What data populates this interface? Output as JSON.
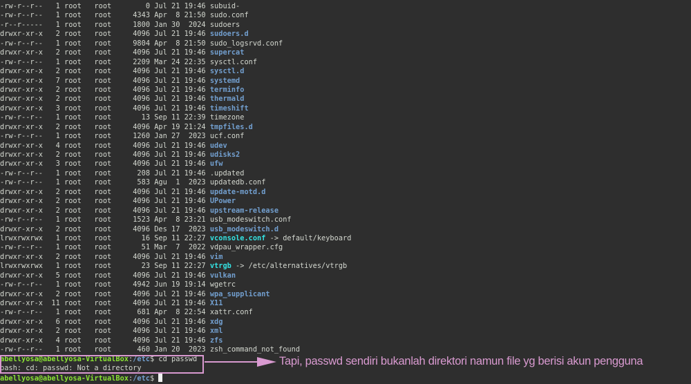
{
  "colors": {
    "background": "#2e2e2e",
    "text": "#d3d7cf",
    "directory": "#729fcf",
    "symlink": "#34e2e2",
    "prompt_user": "#8ae234",
    "annotation": "#d99ad0"
  },
  "listing": [
    {
      "perms": "-rw-r--r--",
      "links": "1",
      "owner": "root",
      "group": "root",
      "size": "0",
      "date": "Jul 21 19:46",
      "name": "subuid-",
      "type": "file"
    },
    {
      "perms": "-rw-r--r--",
      "links": "1",
      "owner": "root",
      "group": "root",
      "size": "4343",
      "date": "Apr  8 21:50",
      "name": "sudo.conf",
      "type": "file"
    },
    {
      "perms": "-r--r-----",
      "links": "1",
      "owner": "root",
      "group": "root",
      "size": "1800",
      "date": "Jan 30  2024",
      "name": "sudoers",
      "type": "file"
    },
    {
      "perms": "drwxr-xr-x",
      "links": "2",
      "owner": "root",
      "group": "root",
      "size": "4096",
      "date": "Jul 21 19:46",
      "name": "sudoers.d",
      "type": "dir"
    },
    {
      "perms": "-rw-r--r--",
      "links": "1",
      "owner": "root",
      "group": "root",
      "size": "9804",
      "date": "Apr  8 21:50",
      "name": "sudo_logsrvd.conf",
      "type": "file"
    },
    {
      "perms": "drwxr-xr-x",
      "links": "2",
      "owner": "root",
      "group": "root",
      "size": "4096",
      "date": "Jul 21 19:46",
      "name": "supercat",
      "type": "dir"
    },
    {
      "perms": "-rw-r--r--",
      "links": "1",
      "owner": "root",
      "group": "root",
      "size": "2209",
      "date": "Mar 24 22:35",
      "name": "sysctl.conf",
      "type": "file"
    },
    {
      "perms": "drwxr-xr-x",
      "links": "2",
      "owner": "root",
      "group": "root",
      "size": "4096",
      "date": "Jul 21 19:46",
      "name": "sysctl.d",
      "type": "dir"
    },
    {
      "perms": "drwxr-xr-x",
      "links": "7",
      "owner": "root",
      "group": "root",
      "size": "4096",
      "date": "Jul 21 19:46",
      "name": "systemd",
      "type": "dir"
    },
    {
      "perms": "drwxr-xr-x",
      "links": "2",
      "owner": "root",
      "group": "root",
      "size": "4096",
      "date": "Jul 21 19:46",
      "name": "terminfo",
      "type": "dir"
    },
    {
      "perms": "drwxr-xr-x",
      "links": "2",
      "owner": "root",
      "group": "root",
      "size": "4096",
      "date": "Jul 21 19:46",
      "name": "thermald",
      "type": "dir"
    },
    {
      "perms": "drwxr-xr-x",
      "links": "3",
      "owner": "root",
      "group": "root",
      "size": "4096",
      "date": "Jul 21 19:46",
      "name": "timeshift",
      "type": "dir"
    },
    {
      "perms": "-rw-r--r--",
      "links": "1",
      "owner": "root",
      "group": "root",
      "size": "13",
      "date": "Sep 11 22:39",
      "name": "timezone",
      "type": "file"
    },
    {
      "perms": "drwxr-xr-x",
      "links": "2",
      "owner": "root",
      "group": "root",
      "size": "4096",
      "date": "Apr 19 21:24",
      "name": "tmpfiles.d",
      "type": "dir"
    },
    {
      "perms": "-rw-r--r--",
      "links": "1",
      "owner": "root",
      "group": "root",
      "size": "1260",
      "date": "Jan 27  2023",
      "name": "ucf.conf",
      "type": "file"
    },
    {
      "perms": "drwxr-xr-x",
      "links": "4",
      "owner": "root",
      "group": "root",
      "size": "4096",
      "date": "Jul 21 19:46",
      "name": "udev",
      "type": "dir"
    },
    {
      "perms": "drwxr-xr-x",
      "links": "2",
      "owner": "root",
      "group": "root",
      "size": "4096",
      "date": "Jul 21 19:46",
      "name": "udisks2",
      "type": "dir"
    },
    {
      "perms": "drwxr-xr-x",
      "links": "3",
      "owner": "root",
      "group": "root",
      "size": "4096",
      "date": "Jul 21 19:46",
      "name": "ufw",
      "type": "dir"
    },
    {
      "perms": "-rw-r--r--",
      "links": "1",
      "owner": "root",
      "group": "root",
      "size": "208",
      "date": "Jul 21 19:46",
      "name": ".updated",
      "type": "file"
    },
    {
      "perms": "-rw-r--r--",
      "links": "1",
      "owner": "root",
      "group": "root",
      "size": "583",
      "date": "Agu  1  2023",
      "name": "updatedb.conf",
      "type": "file"
    },
    {
      "perms": "drwxr-xr-x",
      "links": "2",
      "owner": "root",
      "group": "root",
      "size": "4096",
      "date": "Jul 21 19:46",
      "name": "update-motd.d",
      "type": "dir"
    },
    {
      "perms": "drwxr-xr-x",
      "links": "2",
      "owner": "root",
      "group": "root",
      "size": "4096",
      "date": "Jul 21 19:46",
      "name": "UPower",
      "type": "dir"
    },
    {
      "perms": "drwxr-xr-x",
      "links": "2",
      "owner": "root",
      "group": "root",
      "size": "4096",
      "date": "Jul 21 19:46",
      "name": "upstream-release",
      "type": "dir"
    },
    {
      "perms": "-rw-r--r--",
      "links": "1",
      "owner": "root",
      "group": "root",
      "size": "1523",
      "date": "Apr  8 23:21",
      "name": "usb_modeswitch.conf",
      "type": "file"
    },
    {
      "perms": "drwxr-xr-x",
      "links": "2",
      "owner": "root",
      "group": "root",
      "size": "4096",
      "date": "Des 17  2023",
      "name": "usb_modeswitch.d",
      "type": "dir"
    },
    {
      "perms": "lrwxrwxrwx",
      "links": "1",
      "owner": "root",
      "group": "root",
      "size": "16",
      "date": "Sep 11 22:27",
      "name": "vconsole.conf",
      "type": "link",
      "target": " -> default/keyboard"
    },
    {
      "perms": "-rw-r--r--",
      "links": "1",
      "owner": "root",
      "group": "root",
      "size": "51",
      "date": "Mar  7  2022",
      "name": "vdpau_wrapper.cfg",
      "type": "file"
    },
    {
      "perms": "drwxr-xr-x",
      "links": "2",
      "owner": "root",
      "group": "root",
      "size": "4096",
      "date": "Jul 21 19:46",
      "name": "vim",
      "type": "dir"
    },
    {
      "perms": "lrwxrwxrwx",
      "links": "1",
      "owner": "root",
      "group": "root",
      "size": "23",
      "date": "Sep 11 22:27",
      "name": "vtrgb",
      "type": "link",
      "target": " -> /etc/alternatives/vtrgb"
    },
    {
      "perms": "drwxr-xr-x",
      "links": "5",
      "owner": "root",
      "group": "root",
      "size": "4096",
      "date": "Jul 21 19:46",
      "name": "vulkan",
      "type": "dir"
    },
    {
      "perms": "-rw-r--r--",
      "links": "1",
      "owner": "root",
      "group": "root",
      "size": "4942",
      "date": "Jun 19 19:14",
      "name": "wgetrc",
      "type": "file"
    },
    {
      "perms": "drwxr-xr-x",
      "links": "2",
      "owner": "root",
      "group": "root",
      "size": "4096",
      "date": "Jul 21 19:46",
      "name": "wpa_supplicant",
      "type": "dir"
    },
    {
      "perms": "drwxr-xr-x",
      "links": "11",
      "owner": "root",
      "group": "root",
      "size": "4096",
      "date": "Jul 21 19:46",
      "name": "X11",
      "type": "dir"
    },
    {
      "perms": "-rw-r--r--",
      "links": "1",
      "owner": "root",
      "group": "root",
      "size": "681",
      "date": "Apr  8 22:54",
      "name": "xattr.conf",
      "type": "file"
    },
    {
      "perms": "drwxr-xr-x",
      "links": "6",
      "owner": "root",
      "group": "root",
      "size": "4096",
      "date": "Jul 21 19:46",
      "name": "xdg",
      "type": "dir"
    },
    {
      "perms": "drwxr-xr-x",
      "links": "2",
      "owner": "root",
      "group": "root",
      "size": "4096",
      "date": "Jul 21 19:46",
      "name": "xml",
      "type": "dir"
    },
    {
      "perms": "drwxr-xr-x",
      "links": "4",
      "owner": "root",
      "group": "root",
      "size": "4096",
      "date": "Jul 21 19:46",
      "name": "zfs",
      "type": "dir"
    },
    {
      "perms": "-rw-r--r--",
      "links": "1",
      "owner": "root",
      "group": "root",
      "size": "460",
      "date": "Jan 20  2023",
      "name": "zsh_command_not_found",
      "type": "file"
    }
  ],
  "prompt": {
    "user_host": "abellyosa@abellyosa-VirtualBox",
    "sep": ":",
    "path": "/etc",
    "symbol": "$ "
  },
  "command": "cd passwd",
  "error": "bash: cd: passwd: Not a directory",
  "annotation": "Tapi, passwd sendiri bukanlah direktori namun file yg berisi akun pengguna"
}
